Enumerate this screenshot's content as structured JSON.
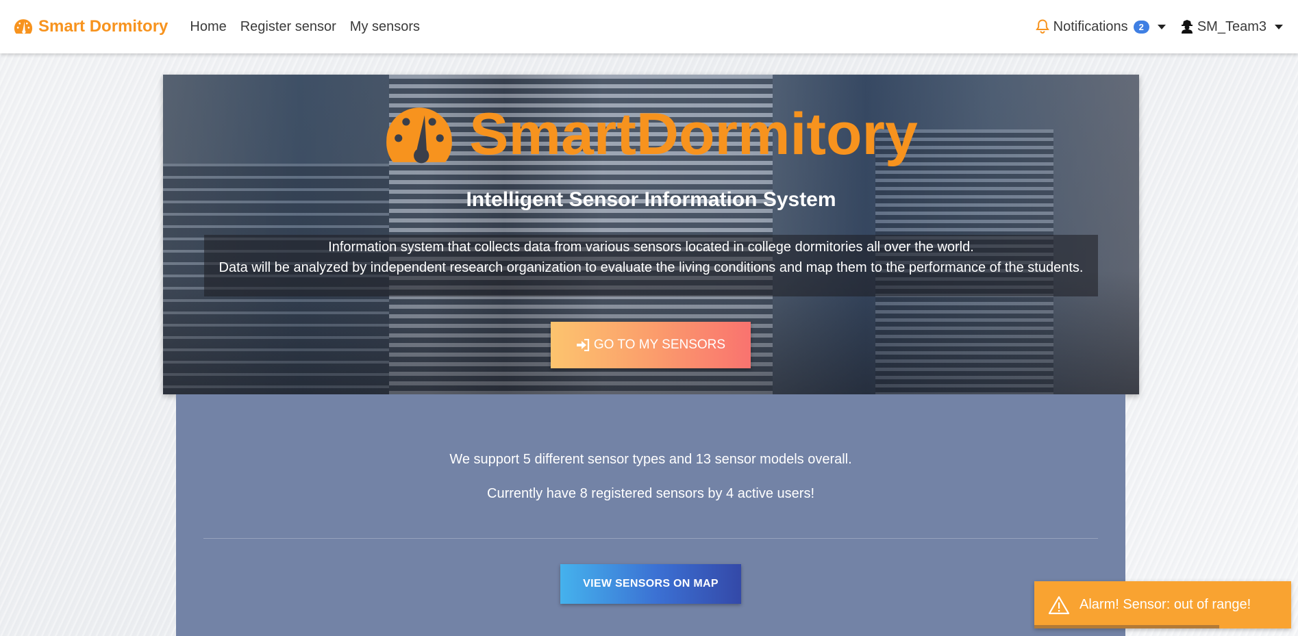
{
  "navbar": {
    "brand": "Smart Dormitory",
    "links": [
      "Home",
      "Register sensor",
      "My sensors"
    ],
    "notifications_label": "Notifications",
    "notifications_count": "2",
    "user_name": "SM_Team3"
  },
  "hero": {
    "title": "SmartDormitory",
    "subtitle": "Intelligent Sensor Information System",
    "desc_line1": "Information system that collects data from various sensors located in college dormitories all over the world.",
    "desc_line2": "Data will be analyzed by independent research organization to evaluate the living conditions and map them to the performance of the students.",
    "button_label": "GO TO MY SENSORS"
  },
  "stats": {
    "line1": "We support 5 different sensor types and 13 sensor models overall.",
    "line2": "Currently have 8 registered sensors by 4 active users!",
    "map_button": "VIEW SENSORS ON MAP"
  },
  "toast": {
    "message": "Alarm! Sensor: out of range!",
    "progress": 0.72
  },
  "colors": {
    "brand": "#f7931e",
    "badge": "#3f7fe3",
    "stats_bg": "#7383a6",
    "toast_bg": "#f9a331"
  },
  "icons": {
    "brand": "tachometer-icon",
    "notifications": "bell-icon",
    "user": "user-secret-icon",
    "hero_button": "sign-in-icon",
    "toast": "warning-icon"
  }
}
